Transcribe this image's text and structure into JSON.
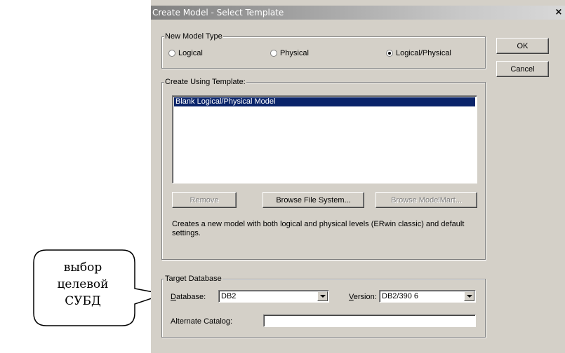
{
  "window": {
    "title": "Create Model - Select Template",
    "close_glyph": "×"
  },
  "new_model_type": {
    "legend": "New Model Type",
    "options": [
      {
        "label": "Logical",
        "selected": false
      },
      {
        "label": "Physical",
        "selected": false
      },
      {
        "label": "Logical/Physical",
        "selected": true
      }
    ]
  },
  "buttons": {
    "ok": "OK",
    "cancel": "Cancel"
  },
  "template": {
    "legend": "Create Using Template:",
    "items": [
      "Blank Logical/Physical Model"
    ],
    "selected_item": "Blank Logical/Physical Model",
    "remove": "Remove",
    "browse_fs": "Browse File System...",
    "browse_mm": "Browse ModelMart...",
    "description": "Creates a new model with both logical and physical levels (ERwin classic) and default settings."
  },
  "target_db": {
    "legend": "Target Database",
    "database_label_first": "D",
    "database_label_rest": "atabase:",
    "database_value": "DB2",
    "version_label_first": "V",
    "version_label_rest": "ersion:",
    "version_value": "DB2/390 6",
    "alternate_catalog_label": "Alternate Catalog:",
    "alternate_catalog_value": ""
  },
  "callout": {
    "lines": [
      "выбор",
      "целевой",
      "СУБД"
    ]
  },
  "colors": {
    "selection": "#0a246a",
    "dialog_bg": "#d4d0c8"
  },
  "icons": {
    "close": "close-icon",
    "dropdown": "chevron-down-icon",
    "radio": "radio-icon"
  }
}
